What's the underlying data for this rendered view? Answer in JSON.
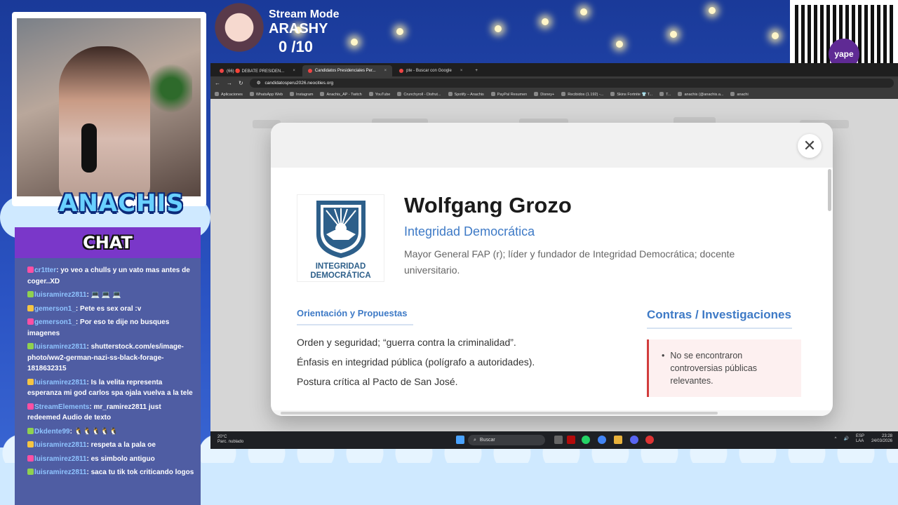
{
  "overlay": {
    "brand_name": "ANACHIS",
    "stream_mode_label": "Stream Mode",
    "streamer_name": "ARASHY",
    "counter": "0  /10",
    "qr_badge": "yape"
  },
  "chat": {
    "title": "CHAT",
    "messages": [
      {
        "user": "cr1tter",
        "text": ": yo veo a chulls y un vato mas antes de coger..XD"
      },
      {
        "user": "luisramirez2811",
        "text": ": 💻 💻 💻"
      },
      {
        "user": "gemerson1_",
        "text": ": Pete es sex oral :v"
      },
      {
        "user": "gemerson1_",
        "text": ": Por eso te dije no busques imagenes"
      },
      {
        "user": "luisramirez2811",
        "text": ": shutterstock.com/es/image-photo/ww2-german-nazi-ss-black-forage-1818632315"
      },
      {
        "user": "luisramirez2811",
        "text": ": Is la velita representa esperanza mi god carlos spa ojala vuelva a la tele"
      },
      {
        "user": "StreamElements",
        "text": ": mr_ramirez2811 just redeemed Audio de texto"
      },
      {
        "user": "Dkdente99",
        "text": ": 🐧🐧🐧🐧🐧"
      },
      {
        "user": "luisramirez2811",
        "text": ": respeta a la pala oe"
      },
      {
        "user": "luisramirez2811",
        "text": ": es simbolo antiguo"
      },
      {
        "user": "luisramirez2811",
        "text": ": saca tu tik tok criticando logos"
      }
    ]
  },
  "browser": {
    "tabs": [
      {
        "label": "(66) 🔴 DEBATE PRESIDEN...",
        "active": false
      },
      {
        "label": "Candidatos Presidenciales Per...",
        "active": true
      },
      {
        "label": "pte - Buscar con Google",
        "active": false
      }
    ],
    "new_tab": "+",
    "url": "candidatosperu2026.neocities.org",
    "bookmarks": [
      "Aplicaciones",
      "WhatsApp Web",
      "Instagram",
      "Anachis_AP - Twitch",
      "YouTube",
      "Crunchyroll - Disfrut...",
      "Spotify – Anachis",
      "PayPal Resumen",
      "Disney+",
      "Recibidos (1.192) -...",
      "Skins Fortnite 👕 T...",
      "T...",
      "anachis (@anachis.a...",
      "anachi"
    ]
  },
  "modal": {
    "close": "✕",
    "logo_text_line1": "INTEGRIDAD",
    "logo_text_line2": "DEMOCRÁTICA",
    "name": "Wolfgang Grozo",
    "party": "Integridad Democrática",
    "bio": "Mayor General FAP (r); líder y fundador de Integridad Democrática; docente universitario.",
    "section_left_title": "Orientación y Propuestas",
    "proposals": [
      "Orden y seguridad; “guerra contra la criminalidad”.",
      "Énfasis en integridad pública (polígrafo a autoridades).",
      "Postura crítica al Pacto de San José."
    ],
    "section_right_title": "Contras / Investigaciones",
    "contras": [
      "No se encontraron controversias públicas relevantes."
    ]
  },
  "taskbar": {
    "weather_temp": "20°C",
    "weather_desc": "Parc. nublado",
    "search_placeholder": "Buscar",
    "lang1": "ESP",
    "lang2": "LAA",
    "time": "23:28",
    "date": "24/03/2026"
  },
  "colors": {
    "accent_blue": "#3e7ac6",
    "contra_red": "#d23c3c",
    "chat_purple": "#7a37c9"
  }
}
